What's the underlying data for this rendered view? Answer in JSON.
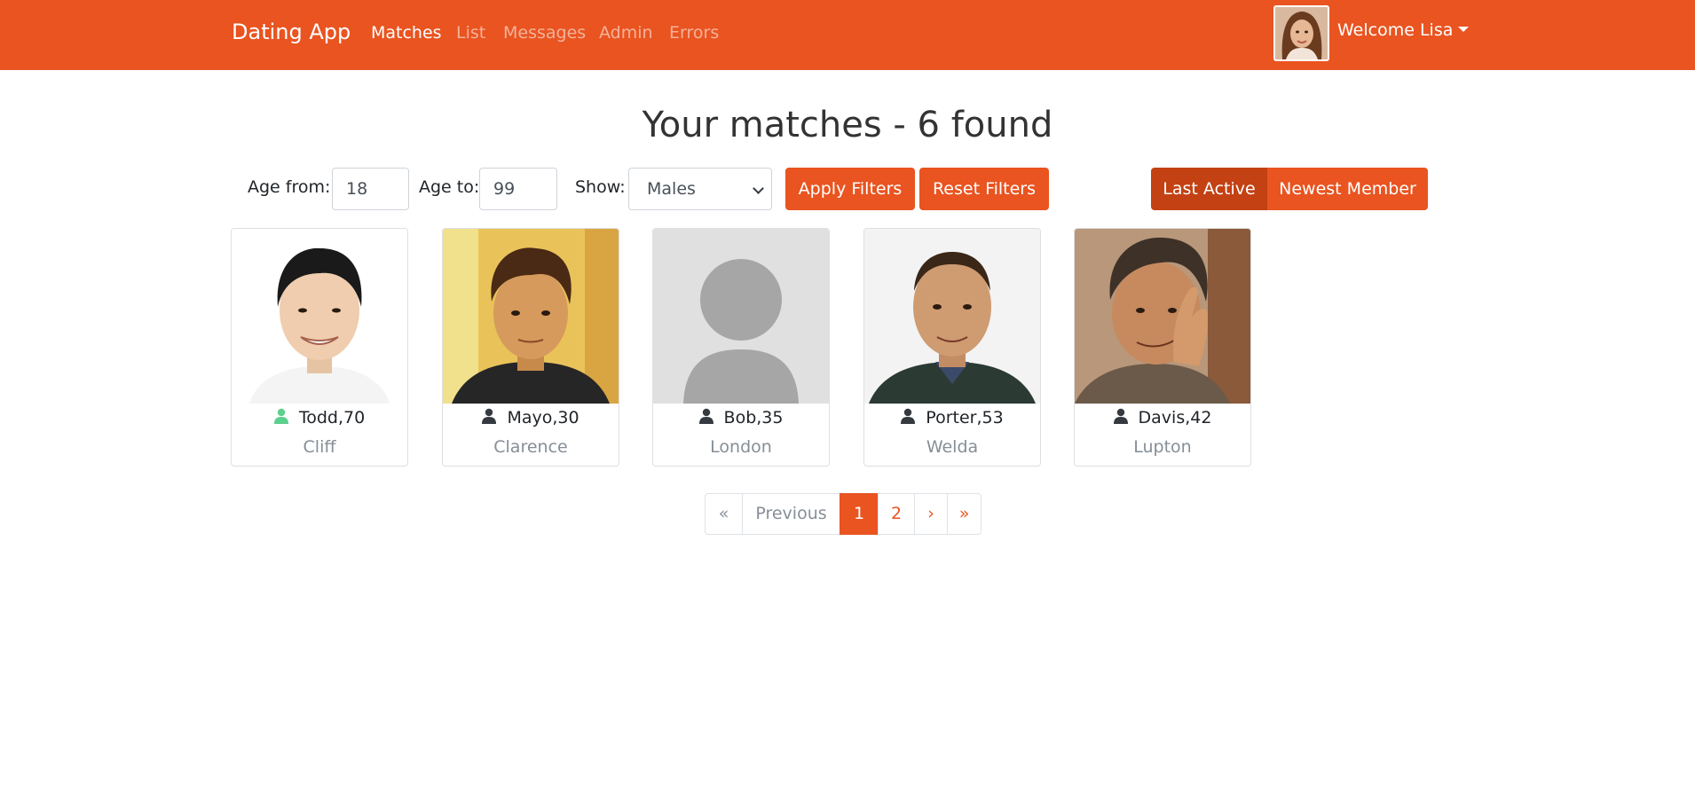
{
  "navbar": {
    "brand": "Dating App",
    "links": [
      {
        "label": "Matches",
        "active": true
      },
      {
        "label": "List",
        "active": false
      },
      {
        "label": "Messages",
        "active": false
      },
      {
        "label": "Admin",
        "active": false
      },
      {
        "label": "Errors",
        "active": false
      }
    ],
    "welcome": "Welcome Lisa",
    "color": "#e95420"
  },
  "page": {
    "title": "Your matches - 6 found"
  },
  "filters": {
    "age_from_label": "Age from:",
    "age_from_value": "18",
    "age_to_label": "Age to:",
    "age_to_value": "99",
    "show_label": "Show:",
    "show_value": "Males",
    "apply_label": "Apply Filters",
    "reset_label": "Reset Filters"
  },
  "sort": {
    "last_active_label": "Last Active",
    "newest_label": "Newest Member",
    "selected": "Last Active"
  },
  "members": [
    {
      "name": "Todd,70",
      "city": "Cliff",
      "online": true
    },
    {
      "name": "Mayo,30",
      "city": "Clarence",
      "online": false
    },
    {
      "name": "Bob,35",
      "city": "London",
      "online": false
    },
    {
      "name": "Porter,53",
      "city": "Welda",
      "online": false
    },
    {
      "name": "Davis,42",
      "city": "Lupton",
      "online": false
    }
  ],
  "pagination": {
    "first": "«",
    "previous": "Previous",
    "pages": [
      "1",
      "2"
    ],
    "current": "1",
    "next": "›",
    "last": "»"
  },
  "colors": {
    "accent": "#e95420",
    "accent_dark": "#c34113",
    "online": "#5cd08d"
  }
}
